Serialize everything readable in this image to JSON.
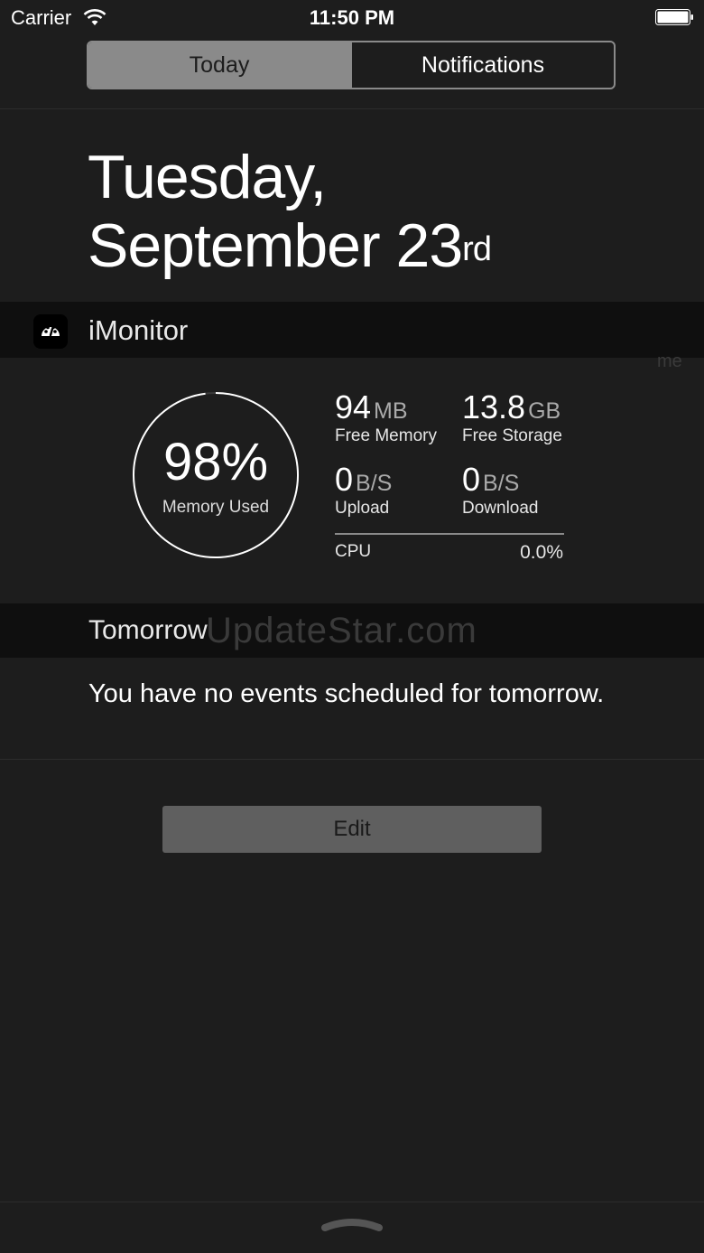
{
  "status_bar": {
    "carrier": "Carrier",
    "time": "11:50 PM",
    "wifi_icon": "wifi-icon",
    "battery_icon": "battery-full-icon"
  },
  "segmented_control": {
    "tabs": [
      {
        "label": "Today",
        "selected": true
      },
      {
        "label": "Notifications",
        "selected": false
      }
    ]
  },
  "date_header": {
    "weekday": "Tuesday,",
    "month_day": "September 23",
    "ordinal_suffix": "rd"
  },
  "imonitor": {
    "title": "iMonitor",
    "icon": "speedometer-icon",
    "memory_used": {
      "value": "98%",
      "label": "Memory Used",
      "fraction": 0.98
    },
    "free_memory": {
      "value": "94",
      "unit": "MB",
      "label": "Free Memory"
    },
    "free_storage": {
      "value": "13.8",
      "unit": "GB",
      "label": "Free Storage"
    },
    "upload": {
      "value": "0",
      "unit": "B/S",
      "label": "Upload"
    },
    "download": {
      "value": "0",
      "unit": "B/S",
      "label": "Download"
    },
    "cpu": {
      "label": "CPU",
      "value": "0.0%"
    }
  },
  "tomorrow": {
    "title": "Tomorrow",
    "message": "You have no events scheduled for tomorrow."
  },
  "edit_button": {
    "label": "Edit"
  },
  "watermark": {
    "text": "UpdateStar.com"
  },
  "ghost_text": "me",
  "colors": {
    "background": "#1d1d1d",
    "header_band": "#0f0f0f",
    "segment_selected": "#8a8a8a",
    "button": "#5f5f5f"
  }
}
